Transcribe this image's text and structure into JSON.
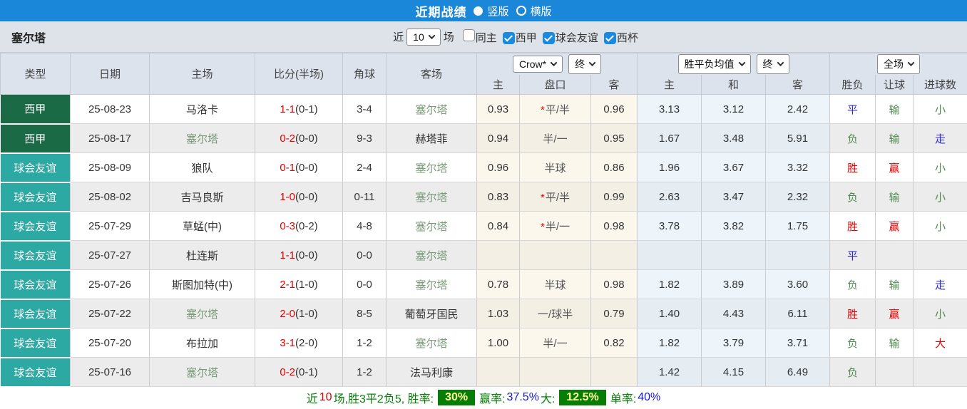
{
  "colors": {
    "topbar": "#1b87d9",
    "liga_badge": "#1a6b45",
    "friendly_badge": "#2ba9a2",
    "win_red": "#e60000",
    "draw_blue": "#2b2bd5",
    "lose_green": "#508a50",
    "focus_team_green": "#7a9a7a",
    "summary_badge_bg": "#067d06",
    "summary_badge_text": "#ffff99"
  },
  "topbar": {
    "title": "近期战绩",
    "radios": [
      {
        "label": "竖版",
        "selected": true
      },
      {
        "label": "横版",
        "selected": false
      }
    ]
  },
  "filter": {
    "team": "塞尔塔",
    "near_label": "近",
    "count_select": "10",
    "games_label": "场",
    "checkboxes": [
      {
        "label": "同主",
        "checked": false
      },
      {
        "label": "西甲",
        "checked": true
      },
      {
        "label": "球会友谊",
        "checked": true
      },
      {
        "label": "西杯",
        "checked": true
      }
    ]
  },
  "table": {
    "main_headers": [
      "类型",
      "日期",
      "主场",
      "比分(半场)",
      "角球",
      "客场"
    ],
    "selects": {
      "ah_company": "Crow*",
      "ah_time": "终",
      "eu_company": "胜平负均值",
      "eu_time": "终",
      "scope": "全场"
    },
    "sub_headers": [
      "主",
      "盘口",
      "客",
      "主",
      "和",
      "客",
      "胜负",
      "让球",
      "进球数"
    ],
    "rows": [
      {
        "type": "西甲",
        "cat": "liga",
        "date": "25-08-23",
        "home": "马洛卡",
        "home_focus": false,
        "ft": "1-1",
        "ht": "(0-1)",
        "corner": "3-4",
        "away": "塞尔塔",
        "away_focus": true,
        "ah_home": "0.93",
        "ah_star": "*",
        "ah_line": "平/半",
        "ah_away": "0.96",
        "eu_home": "3.13",
        "eu_draw": "3.12",
        "eu_away": "2.42",
        "res_wdl": {
          "t": "平",
          "c": "blue"
        },
        "res_ah": {
          "t": "输",
          "c": "green"
        },
        "res_goal": {
          "t": "小",
          "c": "green"
        }
      },
      {
        "type": "西甲",
        "cat": "liga",
        "date": "25-08-17",
        "home": "塞尔塔",
        "home_focus": true,
        "ft": "0-2",
        "ht": "(0-0)",
        "corner": "9-3",
        "away": "赫塔菲",
        "away_focus": false,
        "ah_home": "0.94",
        "ah_star": "",
        "ah_line": "半/一",
        "ah_away": "0.95",
        "eu_home": "1.67",
        "eu_draw": "3.48",
        "eu_away": "5.91",
        "res_wdl": {
          "t": "负",
          "c": "green"
        },
        "res_ah": {
          "t": "输",
          "c": "green"
        },
        "res_goal": {
          "t": "走",
          "c": "blue"
        }
      },
      {
        "type": "球会友谊",
        "cat": "friendly",
        "date": "25-08-09",
        "home": "狼队",
        "home_focus": false,
        "ft": "0-1",
        "ht": "(0-0)",
        "corner": "2-4",
        "away": "塞尔塔",
        "away_focus": true,
        "ah_home": "0.96",
        "ah_star": "",
        "ah_line": "半球",
        "ah_away": "0.86",
        "eu_home": "1.96",
        "eu_draw": "3.67",
        "eu_away": "3.32",
        "res_wdl": {
          "t": "胜",
          "c": "red"
        },
        "res_ah": {
          "t": "赢",
          "c": "red"
        },
        "res_goal": {
          "t": "小",
          "c": "green"
        }
      },
      {
        "type": "球会友谊",
        "cat": "friendly",
        "date": "25-08-02",
        "home": "吉马良斯",
        "home_focus": false,
        "ft": "1-0",
        "ht": "(0-0)",
        "corner": "0-11",
        "away": "塞尔塔",
        "away_focus": true,
        "ah_home": "0.83",
        "ah_star": "*",
        "ah_line": "平/半",
        "ah_away": "0.99",
        "eu_home": "2.63",
        "eu_draw": "3.47",
        "eu_away": "2.32",
        "res_wdl": {
          "t": "负",
          "c": "green"
        },
        "res_ah": {
          "t": "输",
          "c": "green"
        },
        "res_goal": {
          "t": "小",
          "c": "green"
        }
      },
      {
        "type": "球会友谊",
        "cat": "friendly",
        "date": "25-07-29",
        "home": "草蜢(中)",
        "home_focus": false,
        "ft": "0-3",
        "ht": "(0-2)",
        "corner": "4-8",
        "away": "塞尔塔",
        "away_focus": true,
        "ah_home": "0.84",
        "ah_star": "*",
        "ah_line": "半/一",
        "ah_away": "0.98",
        "eu_home": "3.78",
        "eu_draw": "3.82",
        "eu_away": "1.75",
        "res_wdl": {
          "t": "胜",
          "c": "red"
        },
        "res_ah": {
          "t": "赢",
          "c": "red"
        },
        "res_goal": {
          "t": "小",
          "c": "green"
        }
      },
      {
        "type": "球会友谊",
        "cat": "friendly",
        "date": "25-07-27",
        "home": "杜连斯",
        "home_focus": false,
        "ft": "1-1",
        "ht": "(0-0)",
        "corner": "0-0",
        "away": "塞尔塔",
        "away_focus": true,
        "ah_home": "",
        "ah_star": "",
        "ah_line": "",
        "ah_away": "",
        "eu_home": "",
        "eu_draw": "",
        "eu_away": "",
        "res_wdl": {
          "t": "平",
          "c": "blue"
        },
        "res_ah": {
          "t": "",
          "c": "green"
        },
        "res_goal": {
          "t": "",
          "c": "green"
        }
      },
      {
        "type": "球会友谊",
        "cat": "friendly",
        "date": "25-07-26",
        "home": "斯图加特(中)",
        "home_focus": false,
        "ft": "2-1",
        "ht": "(1-0)",
        "corner": "0-0",
        "away": "塞尔塔",
        "away_focus": true,
        "ah_home": "0.78",
        "ah_star": "",
        "ah_line": "半球",
        "ah_away": "0.98",
        "eu_home": "1.82",
        "eu_draw": "3.89",
        "eu_away": "3.60",
        "res_wdl": {
          "t": "负",
          "c": "green"
        },
        "res_ah": {
          "t": "输",
          "c": "green"
        },
        "res_goal": {
          "t": "走",
          "c": "blue"
        }
      },
      {
        "type": "球会友谊",
        "cat": "friendly",
        "date": "25-07-22",
        "home": "塞尔塔",
        "home_focus": true,
        "ft": "2-0",
        "ht": "(1-0)",
        "corner": "8-5",
        "away": "葡萄牙国民",
        "away_focus": false,
        "ah_home": "1.03",
        "ah_star": "",
        "ah_line": "一/球半",
        "ah_away": "0.79",
        "eu_home": "1.40",
        "eu_draw": "4.43",
        "eu_away": "6.11",
        "res_wdl": {
          "t": "胜",
          "c": "red"
        },
        "res_ah": {
          "t": "赢",
          "c": "red"
        },
        "res_goal": {
          "t": "小",
          "c": "green"
        }
      },
      {
        "type": "球会友谊",
        "cat": "friendly",
        "date": "25-07-20",
        "home": "布拉加",
        "home_focus": false,
        "ft": "3-1",
        "ht": "(2-0)",
        "corner": "1-2",
        "away": "塞尔塔",
        "away_focus": true,
        "ah_home": "1.00",
        "ah_star": "",
        "ah_line": "半/一",
        "ah_away": "0.82",
        "eu_home": "1.82",
        "eu_draw": "3.79",
        "eu_away": "3.71",
        "res_wdl": {
          "t": "负",
          "c": "green"
        },
        "res_ah": {
          "t": "输",
          "c": "green"
        },
        "res_goal": {
          "t": "大",
          "c": "red"
        }
      },
      {
        "type": "球会友谊",
        "cat": "friendly",
        "date": "25-07-16",
        "home": "塞尔塔",
        "home_focus": true,
        "ft": "0-2",
        "ht": "(0-1)",
        "corner": "1-2",
        "away": "法马利康",
        "away_focus": false,
        "ah_home": "",
        "ah_star": "",
        "ah_line": "",
        "ah_away": "",
        "eu_home": "1.42",
        "eu_draw": "4.15",
        "eu_away": "6.49",
        "res_wdl": {
          "t": "负",
          "c": "green"
        },
        "res_ah": {
          "t": "",
          "c": "green"
        },
        "res_goal": {
          "t": "",
          "c": "green"
        }
      }
    ]
  },
  "summary": {
    "segments": [
      {
        "text": "近",
        "style": "green"
      },
      {
        "text": "10",
        "style": "red"
      },
      {
        "text": "场,胜3平2负5, 胜率:",
        "style": "green"
      },
      {
        "text": "30%",
        "style": "badge"
      },
      {
        "text": "赢率:",
        "style": "green"
      },
      {
        "text": "37.5%",
        "style": "blue"
      },
      {
        "text": "大:",
        "style": "green"
      },
      {
        "text": "12.5%",
        "style": "badge"
      },
      {
        "text": "单率:",
        "style": "green"
      },
      {
        "text": "40%",
        "style": "blue"
      }
    ]
  }
}
